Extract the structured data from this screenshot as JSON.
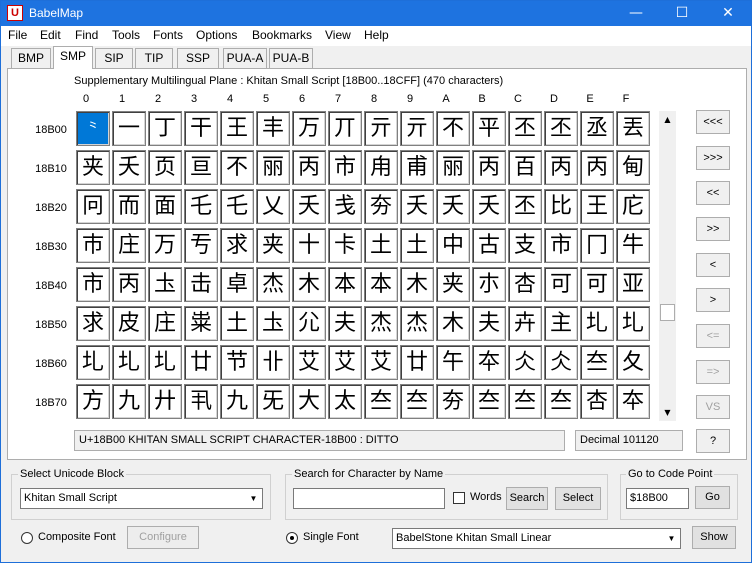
{
  "window": {
    "title": "BabelMap",
    "app_icon": "U",
    "minimize_glyph": "—",
    "maximize_glyph": "☐",
    "close_glyph": "✕"
  },
  "menu": [
    "File",
    "Edit",
    "Find",
    "Tools",
    "Fonts",
    "Options",
    "Bookmarks",
    "View",
    "Help"
  ],
  "tabs": [
    "BMP",
    "SMP",
    "SIP",
    "TIP",
    "SSP",
    "PUA-A",
    "PUA-B"
  ],
  "active_tab": "SMP",
  "plane_label": "Supplementary Multilingual Plane : Khitan Small Script [18B00..18CFF] (470 characters)",
  "column_headers": [
    "0",
    "1",
    "2",
    "3",
    "4",
    "5",
    "6",
    "7",
    "8",
    "9",
    "A",
    "B",
    "C",
    "D",
    "E",
    "F"
  ],
  "row_headers": [
    "18B00",
    "18B10",
    "18B20",
    "18B30",
    "18B40",
    "18B50",
    "18B60",
    "18B70"
  ],
  "grid": [
    [
      "⺀",
      "一",
      "丁",
      "干",
      "王",
      "丰",
      "万",
      "丌",
      "亓",
      "亓",
      "不",
      "平",
      "丕",
      "丕",
      "丞",
      "丟"
    ],
    [
      "夹",
      "夭",
      "页",
      "亘",
      "不",
      "丽",
      "丙",
      "市",
      "甪",
      "甫",
      "丽",
      "丙",
      "百",
      "丙",
      "丙",
      "甸"
    ],
    [
      "冋",
      "而",
      "面",
      "乇",
      "乇",
      "乂",
      "夭",
      "戋",
      "夯",
      "夭",
      "夭",
      "夭",
      "丕",
      "比",
      "王",
      "庀"
    ],
    [
      "巿",
      "庄",
      "万",
      "亐",
      "求",
      "夹",
      "十",
      "卡",
      "土",
      "土",
      "中",
      "古",
      "支",
      "市",
      "冂",
      "牛"
    ],
    [
      "市",
      "丙",
      "圡",
      "击",
      "卓",
      "杰",
      "木",
      "本",
      "本",
      "木",
      "夹",
      "朩",
      "杏",
      "可",
      "可",
      "亚"
    ],
    [
      "求",
      "皮",
      "庄",
      "粜",
      "土",
      "圡",
      "尣",
      "夫",
      "杰",
      "杰",
      "木",
      "夫",
      "卉",
      "主",
      "圠",
      "圠"
    ],
    [
      "圠",
      "圠",
      "圠",
      "廿",
      "节",
      "卝",
      "艾",
      "艾",
      "艾",
      "廿",
      "午",
      "夲",
      "仌",
      "仌",
      "夳",
      "夂"
    ],
    [
      "方",
      "九",
      "廾",
      "丮",
      "九",
      "旡",
      "大",
      "太",
      "夳",
      "夳",
      "夯",
      "夳",
      "夳",
      "夳",
      "杏",
      "夲"
    ]
  ],
  "nav_buttons": [
    "<<<",
    ">>>",
    "<<",
    ">>",
    "<",
    ">",
    "<=",
    "=>",
    "VS"
  ],
  "status": {
    "char_name": "U+18B00 KHITAN SMALL SCRIPT CHARACTER-18B00 : DITTO",
    "decimal": "Decimal 101120",
    "help_label": "?"
  },
  "unicode_block": {
    "label": "Select Unicode Block",
    "value": "Khitan Small Script"
  },
  "search": {
    "label": "Search for Character by Name",
    "value": "",
    "words_label": "Words",
    "search_button": "Search",
    "select_button": "Select"
  },
  "goto": {
    "label": "Go to Code Point",
    "value": "$18B00",
    "go_button": "Go"
  },
  "font_mode": {
    "composite_label": "Composite Font",
    "configure_button": "Configure",
    "single_label": "Single Font",
    "font_value": "BabelStone Khitan Small Linear",
    "show_button": "Show"
  }
}
